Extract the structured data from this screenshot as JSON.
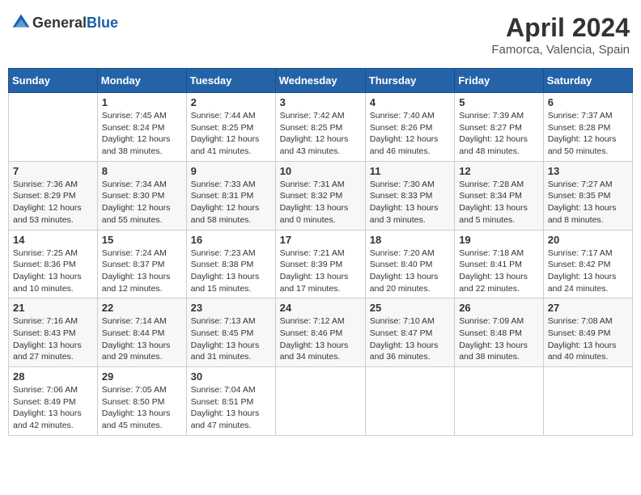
{
  "header": {
    "logo": {
      "general": "General",
      "blue": "Blue"
    },
    "title": "April 2024",
    "subtitle": "Famorca, Valencia, Spain"
  },
  "calendar": {
    "days_of_week": [
      "Sunday",
      "Monday",
      "Tuesday",
      "Wednesday",
      "Thursday",
      "Friday",
      "Saturday"
    ],
    "weeks": [
      [
        {
          "day": "",
          "sunrise": "",
          "sunset": "",
          "daylight": ""
        },
        {
          "day": "1",
          "sunrise": "Sunrise: 7:45 AM",
          "sunset": "Sunset: 8:24 PM",
          "daylight": "Daylight: 12 hours and 38 minutes."
        },
        {
          "day": "2",
          "sunrise": "Sunrise: 7:44 AM",
          "sunset": "Sunset: 8:25 PM",
          "daylight": "Daylight: 12 hours and 41 minutes."
        },
        {
          "day": "3",
          "sunrise": "Sunrise: 7:42 AM",
          "sunset": "Sunset: 8:25 PM",
          "daylight": "Daylight: 12 hours and 43 minutes."
        },
        {
          "day": "4",
          "sunrise": "Sunrise: 7:40 AM",
          "sunset": "Sunset: 8:26 PM",
          "daylight": "Daylight: 12 hours and 46 minutes."
        },
        {
          "day": "5",
          "sunrise": "Sunrise: 7:39 AM",
          "sunset": "Sunset: 8:27 PM",
          "daylight": "Daylight: 12 hours and 48 minutes."
        },
        {
          "day": "6",
          "sunrise": "Sunrise: 7:37 AM",
          "sunset": "Sunset: 8:28 PM",
          "daylight": "Daylight: 12 hours and 50 minutes."
        }
      ],
      [
        {
          "day": "7",
          "sunrise": "Sunrise: 7:36 AM",
          "sunset": "Sunset: 8:29 PM",
          "daylight": "Daylight: 12 hours and 53 minutes."
        },
        {
          "day": "8",
          "sunrise": "Sunrise: 7:34 AM",
          "sunset": "Sunset: 8:30 PM",
          "daylight": "Daylight: 12 hours and 55 minutes."
        },
        {
          "day": "9",
          "sunrise": "Sunrise: 7:33 AM",
          "sunset": "Sunset: 8:31 PM",
          "daylight": "Daylight: 12 hours and 58 minutes."
        },
        {
          "day": "10",
          "sunrise": "Sunrise: 7:31 AM",
          "sunset": "Sunset: 8:32 PM",
          "daylight": "Daylight: 13 hours and 0 minutes."
        },
        {
          "day": "11",
          "sunrise": "Sunrise: 7:30 AM",
          "sunset": "Sunset: 8:33 PM",
          "daylight": "Daylight: 13 hours and 3 minutes."
        },
        {
          "day": "12",
          "sunrise": "Sunrise: 7:28 AM",
          "sunset": "Sunset: 8:34 PM",
          "daylight": "Daylight: 13 hours and 5 minutes."
        },
        {
          "day": "13",
          "sunrise": "Sunrise: 7:27 AM",
          "sunset": "Sunset: 8:35 PM",
          "daylight": "Daylight: 13 hours and 8 minutes."
        }
      ],
      [
        {
          "day": "14",
          "sunrise": "Sunrise: 7:25 AM",
          "sunset": "Sunset: 8:36 PM",
          "daylight": "Daylight: 13 hours and 10 minutes."
        },
        {
          "day": "15",
          "sunrise": "Sunrise: 7:24 AM",
          "sunset": "Sunset: 8:37 PM",
          "daylight": "Daylight: 13 hours and 12 minutes."
        },
        {
          "day": "16",
          "sunrise": "Sunrise: 7:23 AM",
          "sunset": "Sunset: 8:38 PM",
          "daylight": "Daylight: 13 hours and 15 minutes."
        },
        {
          "day": "17",
          "sunrise": "Sunrise: 7:21 AM",
          "sunset": "Sunset: 8:39 PM",
          "daylight": "Daylight: 13 hours and 17 minutes."
        },
        {
          "day": "18",
          "sunrise": "Sunrise: 7:20 AM",
          "sunset": "Sunset: 8:40 PM",
          "daylight": "Daylight: 13 hours and 20 minutes."
        },
        {
          "day": "19",
          "sunrise": "Sunrise: 7:18 AM",
          "sunset": "Sunset: 8:41 PM",
          "daylight": "Daylight: 13 hours and 22 minutes."
        },
        {
          "day": "20",
          "sunrise": "Sunrise: 7:17 AM",
          "sunset": "Sunset: 8:42 PM",
          "daylight": "Daylight: 13 hours and 24 minutes."
        }
      ],
      [
        {
          "day": "21",
          "sunrise": "Sunrise: 7:16 AM",
          "sunset": "Sunset: 8:43 PM",
          "daylight": "Daylight: 13 hours and 27 minutes."
        },
        {
          "day": "22",
          "sunrise": "Sunrise: 7:14 AM",
          "sunset": "Sunset: 8:44 PM",
          "daylight": "Daylight: 13 hours and 29 minutes."
        },
        {
          "day": "23",
          "sunrise": "Sunrise: 7:13 AM",
          "sunset": "Sunset: 8:45 PM",
          "daylight": "Daylight: 13 hours and 31 minutes."
        },
        {
          "day": "24",
          "sunrise": "Sunrise: 7:12 AM",
          "sunset": "Sunset: 8:46 PM",
          "daylight": "Daylight: 13 hours and 34 minutes."
        },
        {
          "day": "25",
          "sunrise": "Sunrise: 7:10 AM",
          "sunset": "Sunset: 8:47 PM",
          "daylight": "Daylight: 13 hours and 36 minutes."
        },
        {
          "day": "26",
          "sunrise": "Sunrise: 7:09 AM",
          "sunset": "Sunset: 8:48 PM",
          "daylight": "Daylight: 13 hours and 38 minutes."
        },
        {
          "day": "27",
          "sunrise": "Sunrise: 7:08 AM",
          "sunset": "Sunset: 8:49 PM",
          "daylight": "Daylight: 13 hours and 40 minutes."
        }
      ],
      [
        {
          "day": "28",
          "sunrise": "Sunrise: 7:06 AM",
          "sunset": "Sunset: 8:49 PM",
          "daylight": "Daylight: 13 hours and 42 minutes."
        },
        {
          "day": "29",
          "sunrise": "Sunrise: 7:05 AM",
          "sunset": "Sunset: 8:50 PM",
          "daylight": "Daylight: 13 hours and 45 minutes."
        },
        {
          "day": "30",
          "sunrise": "Sunrise: 7:04 AM",
          "sunset": "Sunset: 8:51 PM",
          "daylight": "Daylight: 13 hours and 47 minutes."
        },
        {
          "day": "",
          "sunrise": "",
          "sunset": "",
          "daylight": ""
        },
        {
          "day": "",
          "sunrise": "",
          "sunset": "",
          "daylight": ""
        },
        {
          "day": "",
          "sunrise": "",
          "sunset": "",
          "daylight": ""
        },
        {
          "day": "",
          "sunrise": "",
          "sunset": "",
          "daylight": ""
        }
      ]
    ]
  }
}
